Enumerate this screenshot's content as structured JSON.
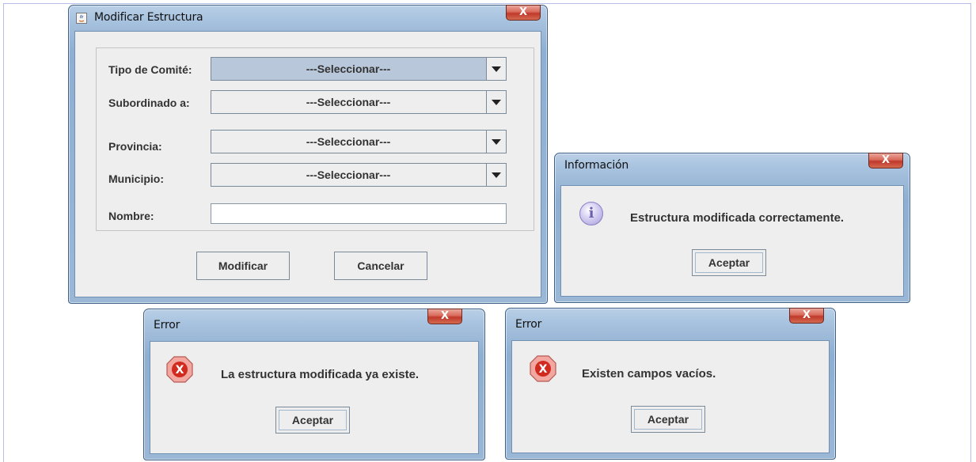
{
  "main_dialog": {
    "title": "Modificar Estructura",
    "fields": [
      {
        "label": "Tipo de Comité:",
        "value": "---Seleccionar---"
      },
      {
        "label": "Subordinado a:",
        "value": "---Seleccionar---"
      },
      {
        "label": "Provincia:",
        "value": "---Seleccionar---"
      },
      {
        "label": "Municipio:",
        "value": "---Seleccionar---"
      }
    ],
    "nombre_label": "Nombre:",
    "nombre_value": "",
    "modify_button": "Modificar",
    "cancel_button": "Cancelar",
    "close_glyph": "X"
  },
  "info_dialog": {
    "title": "Información",
    "icon": "info-icon",
    "message": "Estructura modificada correctamente.",
    "ok_button": "Aceptar"
  },
  "error_dialog_1": {
    "title": "Error",
    "icon": "error-icon",
    "message": "La estructura modificada ya existe.",
    "ok_button": "Aceptar"
  },
  "error_dialog_2": {
    "title": "Error",
    "icon": "error-icon",
    "message": "Existen campos vacíos.",
    "ok_button": "Aceptar"
  }
}
